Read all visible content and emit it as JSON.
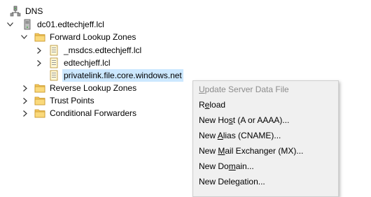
{
  "tree": {
    "root": {
      "label": "DNS",
      "icon": "dns-server-tree-icon"
    },
    "server": {
      "label": "dc01.edtechjeff.lcl",
      "icon": "server-computer-icon"
    },
    "forward": {
      "label": "Forward Lookup Zones",
      "icon": "folder-icon"
    },
    "zones": [
      {
        "label": "_msdcs.edtechjeff.lcl",
        "icon": "zone-file-icon"
      },
      {
        "label": "edtechjeff.lcl",
        "icon": "zone-file-icon"
      },
      {
        "label": "privatelink.file.core.windows.net",
        "icon": "zone-file-icon",
        "selected": true
      }
    ],
    "reverse": {
      "label": "Reverse Lookup Zones",
      "icon": "folder-icon"
    },
    "trust": {
      "label": "Trust Points",
      "icon": "folder-icon"
    },
    "conditional": {
      "label": "Conditional Forwarders",
      "icon": "folder-icon"
    }
  },
  "context_menu": {
    "items": [
      {
        "pre": "",
        "u": "U",
        "post": "pdate Server Data File",
        "disabled": true
      },
      {
        "pre": "R",
        "u": "e",
        "post": "load",
        "disabled": false
      },
      {
        "pre": "New Ho",
        "u": "s",
        "post": "t (A or AAAA)...",
        "disabled": false
      },
      {
        "pre": "New ",
        "u": "A",
        "post": "lias (CNAME)...",
        "disabled": false
      },
      {
        "pre": "New ",
        "u": "M",
        "post": "ail Exchanger (MX)...",
        "disabled": false
      },
      {
        "pre": "New Do",
        "u": "m",
        "post": "ain...",
        "disabled": false
      },
      {
        "pre": "New Dele",
        "u": "g",
        "post": "ation...",
        "disabled": false
      }
    ]
  },
  "colors": {
    "selection": "#cce8ff",
    "menu_bg": "#f0f0f0",
    "disabled_text": "#8c8c8c"
  }
}
